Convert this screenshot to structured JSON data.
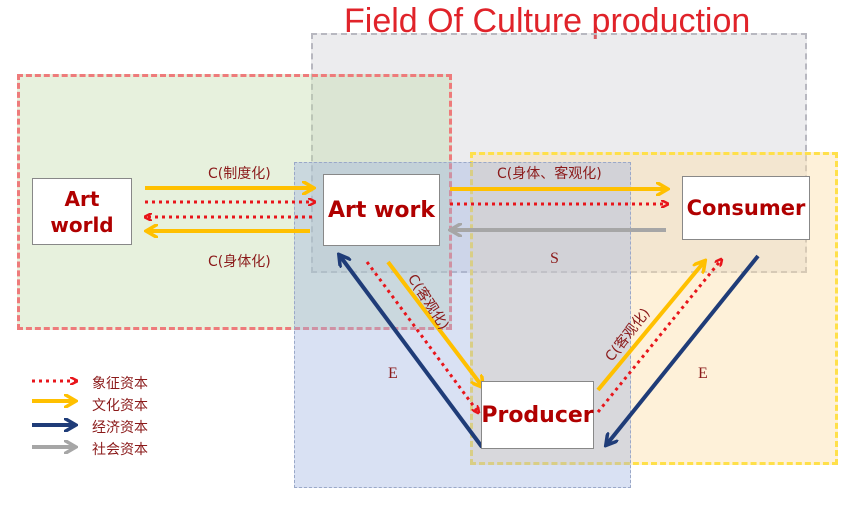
{
  "title": "Field  Of Culture production",
  "nodes": {
    "art_world": "Art\nworld",
    "art_work": "Art work",
    "consumer": "Consumer",
    "producer": "Producer"
  },
  "edge_labels": {
    "institutional": "C(制度化)",
    "embodied": "C(身体化)",
    "embodied_objectified": "C(身体、客观化)",
    "objectified_down": "C(客观化)",
    "objectified_up": "C(客观化)",
    "social": "S",
    "economic_left": "E",
    "economic_right": "E"
  },
  "legend": [
    {
      "label": "象征资本",
      "color": "#e8151b",
      "style": "dotted"
    },
    {
      "label": "文化资本",
      "color": "#ffc000",
      "style": "solid"
    },
    {
      "label": "经济资本",
      "color": "#1f3c78",
      "style": "solid"
    },
    {
      "label": "社会资本",
      "color": "#a6a6a6",
      "style": "solid"
    }
  ],
  "colors": {
    "symbolic": "#e8151b",
    "cultural": "#ffc000",
    "economic": "#1f3c78",
    "social": "#a6a6a6",
    "title": "#e0232a"
  }
}
